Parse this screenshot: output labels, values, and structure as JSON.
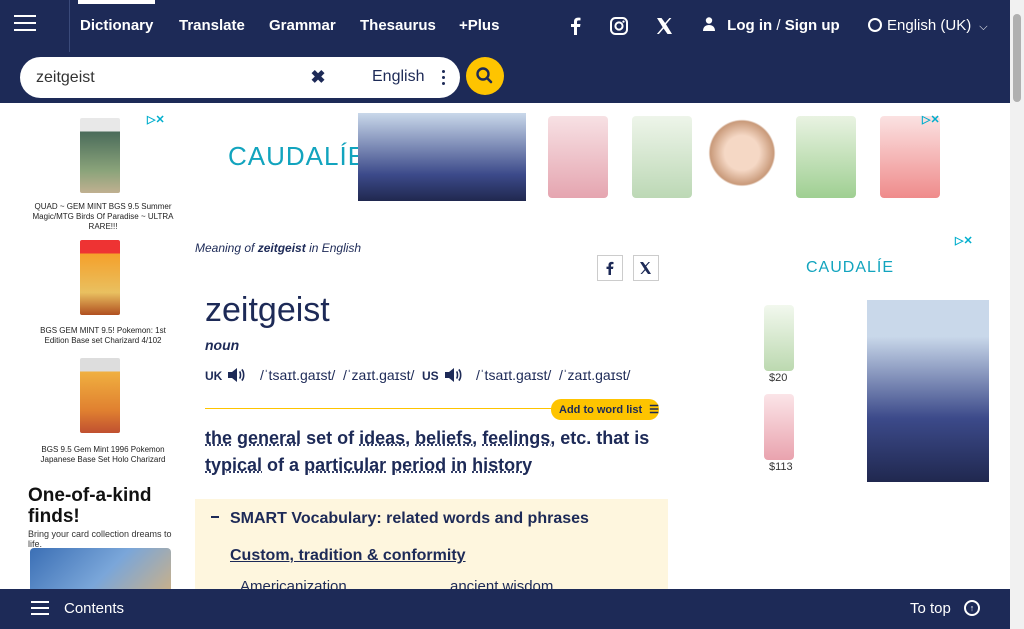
{
  "nav": {
    "links": [
      "Dictionary",
      "Translate",
      "Grammar",
      "Thesaurus",
      "+Plus"
    ],
    "login_label": "Log in",
    "login_separator": "/",
    "signup_label": "Sign up",
    "language": "English (UK)"
  },
  "search": {
    "value": "zeitgeist",
    "dictionary": "English"
  },
  "ads": {
    "left_items": [
      "QUAD ~ GEM MINT BGS 9.5 Summer Magic/MTG Birds Of Paradise ~ ULTRA RARE!!!",
      "BGS GEM MINT 9.5! Pokemon: 1st Edition Base set Charizard 4/102",
      "BGS 9.5 Gem Mint 1996 Pokemon Japanese Base Set Holo Charizard"
    ],
    "left_promo_title": "One-of-a-kind finds!",
    "left_promo_sub": "Bring your card collection dreams to life.",
    "brand": "CAUDALÍE",
    "prices": [
      "$20",
      "$113"
    ]
  },
  "entry": {
    "meaning_prefix": "Meaning of",
    "meaning_word": "zeitgeist",
    "meaning_suffix": "in English",
    "headword": "zeitgeist",
    "pos": "noun",
    "uk_label": "UK",
    "us_label": "US",
    "uk_ipa": [
      "/ˈtsaɪt.ɡaɪst/",
      "/ˈzaɪt.ɡaɪst/"
    ],
    "us_ipa": [
      "/ˈtsaɪt.ɡaɪst/",
      "/ˈzaɪt.ɡaɪst/"
    ],
    "add_to_list": "Add to word list",
    "definition_line1": [
      "the",
      "general",
      "set of",
      "ideas,",
      "beliefs,",
      "feelings,",
      "etc. that is"
    ],
    "definition_line2": [
      "typical",
      "of a",
      "particular",
      "period",
      "in",
      "history"
    ]
  },
  "smart_vocab": {
    "heading": "SMART Vocabulary: related words and phrases",
    "category": "Custom, tradition & conformity",
    "related": [
      "Americanization",
      "ancient wisdom"
    ]
  },
  "bottom": {
    "contents": "Contents",
    "to_top": "To top"
  }
}
